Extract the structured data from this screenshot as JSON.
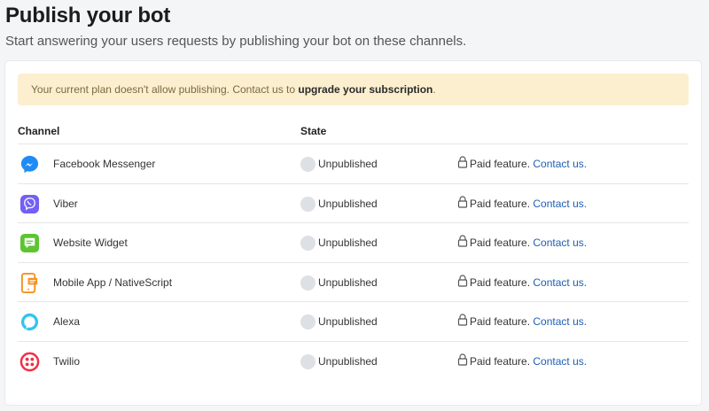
{
  "page": {
    "title": "Publish your bot",
    "subtitle": "Start answering your users requests by publishing your bot on these channels."
  },
  "alert": {
    "text": "Your current plan doesn't allow publishing. Contact us to ",
    "link": "upgrade your subscription",
    "suffix": "."
  },
  "table": {
    "headers": {
      "channel": "Channel",
      "state": "State"
    },
    "rows": [
      {
        "channel": "Facebook Messenger",
        "icon": "messenger-icon",
        "state": "Unpublished",
        "paid": "Paid feature.",
        "contact": "Contact us."
      },
      {
        "channel": "Viber",
        "icon": "viber-icon",
        "state": "Unpublished",
        "paid": "Paid feature.",
        "contact": "Contact us."
      },
      {
        "channel": "Website Widget",
        "icon": "website-widget-icon",
        "state": "Unpublished",
        "paid": "Paid feature.",
        "contact": "Contact us."
      },
      {
        "channel": "Mobile App / NativeScript",
        "icon": "mobile-app-icon",
        "state": "Unpublished",
        "paid": "Paid feature.",
        "contact": "Contact us."
      },
      {
        "channel": "Alexa",
        "icon": "alexa-icon",
        "state": "Unpublished",
        "paid": "Paid feature.",
        "contact": "Contact us."
      },
      {
        "channel": "Twilio",
        "icon": "twilio-icon",
        "state": "Unpublished",
        "paid": "Paid feature.",
        "contact": "Contact us."
      }
    ]
  },
  "colors": {
    "alert_bg": "#fcefcf",
    "link": "#1e5fb4",
    "messenger": "#1e8bf5",
    "viber": "#7360f2",
    "widget": "#5cc531",
    "mobile": "#f6921e",
    "alexa": "#31c4f3",
    "twilio": "#f22f46"
  }
}
